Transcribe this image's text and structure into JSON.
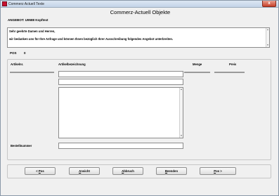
{
  "window": {
    "title": "Commerz Actuell Texte",
    "close_label": "x"
  },
  "page": {
    "title": "Commerz-Actuell Objekte"
  },
  "offer": {
    "label": "ANGEBOT:",
    "number": "U9588",
    "suffix": "Kopftext"
  },
  "letter": {
    "line1": "Sehr geehrte Damen und Herren,",
    "line2": "wir bedanken uns für Ihre Anfrage und können Ihnen bezüglich Ihrer Ausschreibung folgendes Angebot unterbreiten."
  },
  "position": {
    "label": "POS",
    "value": "0"
  },
  "columns": {
    "article_no": "Artikelnr.",
    "article_desc": "Artikelbezeichnung",
    "quantity": "Menge",
    "price": "Preis"
  },
  "order_number": {
    "label": "Bestellnummer"
  },
  "icons": {
    "scroll_up": "▲",
    "scroll_down": "▼"
  },
  "buttons": {
    "back": {
      "pre": "< ",
      "key": "P",
      "rest": "os"
    },
    "view": {
      "key": "A",
      "rest": "nsicht"
    },
    "cancel": {
      "key": "A",
      "rest": "bbruch"
    },
    "finish": {
      "key": "B",
      "rest": "eenden"
    },
    "next": {
      "key": "P",
      "rest": "os",
      "post": " >"
    }
  }
}
